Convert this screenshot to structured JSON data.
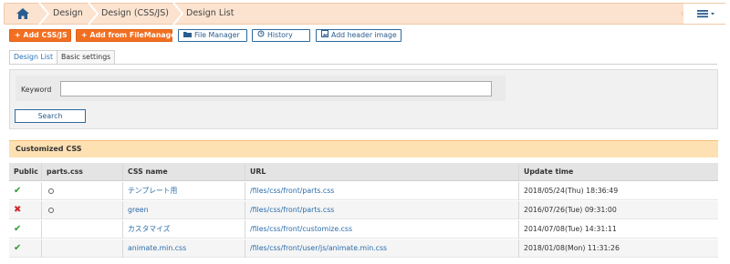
{
  "breadcrumb": {
    "home_icon": "home-icon",
    "items": [
      "Design",
      "Design (CSS/JS)",
      "Design List"
    ],
    "menu_icon": "hamburger-menu-icon"
  },
  "toolbar": {
    "add_css_js": "Add CSS/JS",
    "add_from_filemanager": "Add from FileManager",
    "file_manager": "File Manager",
    "history": "History",
    "add_header_image": "Add header image"
  },
  "tabs": [
    {
      "label": "Design List",
      "active": true
    },
    {
      "label": "Basic settings",
      "active": false
    }
  ],
  "search": {
    "keyword_label": "Keyword",
    "keyword_value": "",
    "search_button": "Search"
  },
  "section_title": "Customized CSS",
  "table": {
    "headers": [
      "Public",
      "parts.css",
      "CSS name",
      "URL",
      "Update time"
    ],
    "rows": [
      {
        "public": "check",
        "parts": "radio",
        "name": "テンプレート用",
        "url": "/files/css/front/parts.css",
        "updated": "2018/05/24(Thu) 18:36:49"
      },
      {
        "public": "cross",
        "parts": "radio",
        "name": "green",
        "url": "/files/css/front/parts.css",
        "updated": "2016/07/26(Tue) 09:31:00"
      },
      {
        "public": "check",
        "parts": "",
        "name": "カスタマイズ",
        "url": "/files/css/front/customize.css",
        "updated": "2014/07/08(Tue) 14:31:11"
      },
      {
        "public": "check",
        "parts": "",
        "name": "animate.min.css",
        "url": "/files/css/front/user/js/animate.min.css",
        "updated": "2018/01/08(Mon) 11:31:26"
      }
    ]
  },
  "colors": {
    "accent_orange": "#f26f21",
    "breadcrumb_bg": "#fbe3cf",
    "section_bg": "#fde1b3",
    "link_blue": "#2a6cab",
    "check_green": "#2e9a2e",
    "cross_red": "#d1262d"
  }
}
